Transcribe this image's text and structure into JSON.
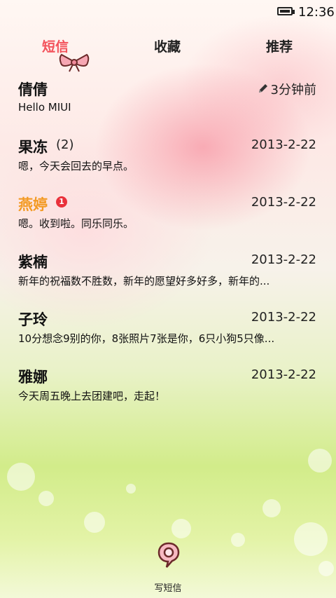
{
  "status_bar": {
    "time": "12:36",
    "battery_icon": "battery-full-icon"
  },
  "tabs": [
    {
      "label": "短信",
      "active": true
    },
    {
      "label": "收藏",
      "active": false
    },
    {
      "label": "推荐",
      "active": false
    }
  ],
  "threads": [
    {
      "name": "倩倩",
      "count": "",
      "unread": "",
      "time": "3分钟前",
      "draft": true,
      "preview": "Hello MIUI"
    },
    {
      "name": "果冻",
      "count": "(2)",
      "unread": "",
      "time": "2013-2-22",
      "draft": false,
      "preview": "嗯，今天会回去的早点。"
    },
    {
      "name": "燕婷",
      "count": "",
      "unread": "1",
      "time": "2013-2-22",
      "draft": false,
      "preview": "嗯。收到啦。同乐同乐。"
    },
    {
      "name": "紫楠",
      "count": "",
      "unread": "",
      "time": "2013-2-22",
      "draft": false,
      "preview": "新年的祝福数不胜数，新年的愿望好多好多，新年的..."
    },
    {
      "name": "子玲",
      "count": "",
      "unread": "",
      "time": "2013-2-22",
      "draft": false,
      "preview": "10分想念9别的你，8张照片7张是你，6只小狗5只像..."
    },
    {
      "name": "雅娜",
      "count": "",
      "unread": "",
      "time": "2013-2-22",
      "draft": false,
      "preview": "今天周五晚上去团建吧，走起！"
    }
  ],
  "compose": {
    "label": "写短信",
    "icon": "compose-message-icon"
  },
  "colors": {
    "active_tab": "#f3525b",
    "unread_name": "#f39a23",
    "badge": "#e9313b"
  }
}
